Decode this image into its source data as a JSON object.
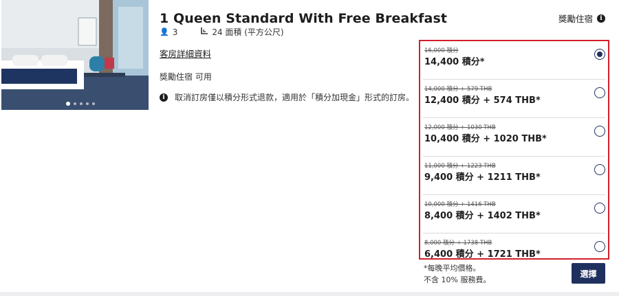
{
  "room": {
    "title": "1 Queen Standard With Free Breakfast",
    "guests": "3",
    "area": "24 面積 (平方公尺)",
    "details_link": "客房詳細資料",
    "availability": "獎勵住宿 可用",
    "cancellation_notice": "取消訂房僅以積分形式退款，適用於「積分加現金」形式的訂房。",
    "photo_slide_count": 5,
    "photo_active_index": 0
  },
  "rewards": {
    "header": "獎勵住宿"
  },
  "rates": [
    {
      "original": "16,000 積分",
      "price": "14,400 積分*",
      "selected": true
    },
    {
      "original": "14,000 積分 + 579 THB",
      "price": "12,400 積分 + 574 THB*",
      "selected": false
    },
    {
      "original": "12,000 積分 + 1030 THB",
      "price": "10,400 積分 + 1020 THB*",
      "selected": false
    },
    {
      "original": "11,000 積分 + 1223 THB",
      "price": "9,400 積分 + 1211 THB*",
      "selected": false
    },
    {
      "original": "10,000 積分 + 1416 THB",
      "price": "8,400 積分 + 1402 THB*",
      "selected": false
    },
    {
      "original": "8,000 積分 + 1738 THB",
      "price": "6,400 積分 + 1721 THB*",
      "selected": false
    }
  ],
  "footnote": {
    "line1": "*每晚平均價格。",
    "line2": "不含 10% 服務費。"
  },
  "select_button": "選擇",
  "colors": {
    "accent_navy": "#1f2f5e",
    "highlight_red": "#d11f2a"
  }
}
